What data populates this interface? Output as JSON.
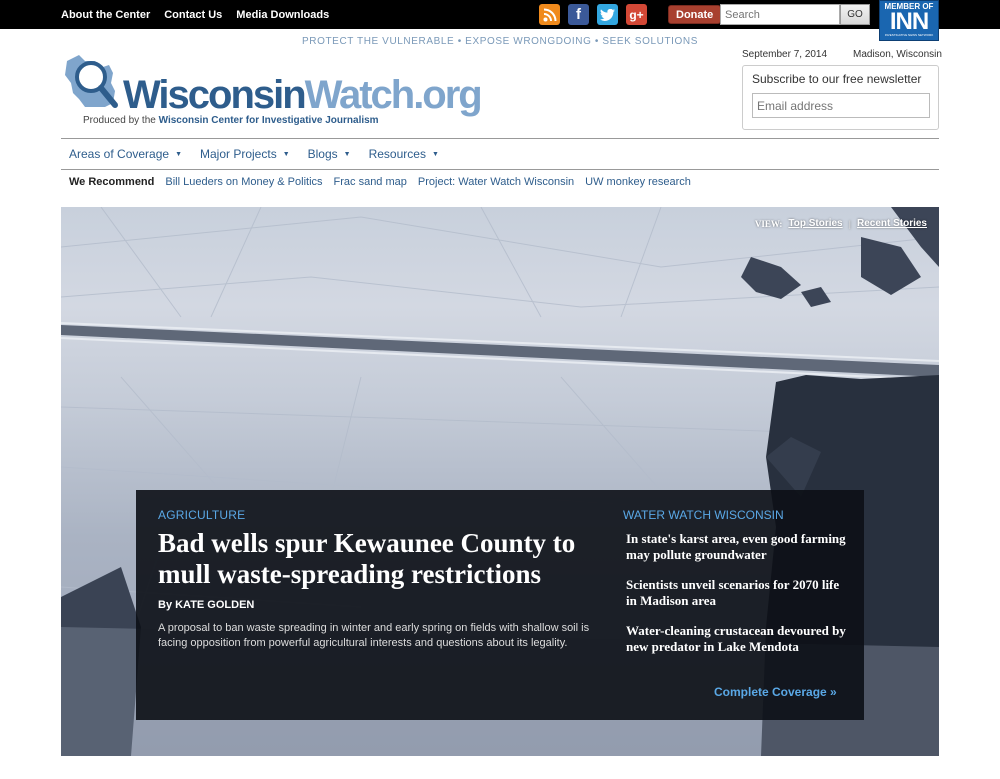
{
  "topbar": {
    "links": [
      "About the Center",
      "Contact Us",
      "Media Downloads"
    ],
    "social_icons": [
      "rss-icon",
      "facebook-icon",
      "twitter-icon",
      "google-plus-icon"
    ],
    "donate_label": "Donate",
    "search_placeholder": "Search",
    "go_label": "GO",
    "inn_badge": {
      "top": "MEMBER OF",
      "main": "INN",
      "sub": "INVESTIGATIVE NEWS NETWORK"
    }
  },
  "header": {
    "tagline": "PROTECT THE VULNERABLE • EXPOSE WRONGDOING • SEEK SOLUTIONS",
    "logo_part1": "Wisconsin",
    "logo_part2": "Watch.org",
    "produced_prefix": "Produced by the ",
    "produced_org": "Wisconsin Center for Investigative Journalism",
    "date": "September 7, 2014",
    "location": "Madison, Wisconsin",
    "newsletter_title": "Subscribe to our free newsletter",
    "newsletter_placeholder": "Email address"
  },
  "nav": {
    "items": [
      "Areas of Coverage",
      "Major Projects",
      "Blogs",
      "Resources"
    ]
  },
  "recommend": {
    "label": "We Recommend",
    "links": [
      "Bill Lueders on Money & Politics",
      "Frac sand map",
      "Project: Water Watch Wisconsin",
      "UW monkey research"
    ]
  },
  "hero": {
    "view_label": "VIEW:",
    "view_options": [
      "Top Stories",
      "Recent Stories"
    ],
    "category": "AGRICULTURE",
    "headline": "Bad wells spur Kewaunee County to mull waste-spreading restrictions",
    "byline": "By KATE GOLDEN",
    "summary": "A proposal to ban waste spreading in winter and early spring on fields with shallow soil is facing opposition from powerful agricultural interests and questions about its legality.",
    "side_category": "WATER WATCH WISCONSIN",
    "side_stories": [
      "In state's karst area, even good farming may pollute groundwater",
      "Scientists unveil scenarios for 2070 life in Madison area",
      "Water-cleaning crustacean devoured by new predator in Lake Mendota"
    ],
    "complete_label": "Complete Coverage »"
  }
}
